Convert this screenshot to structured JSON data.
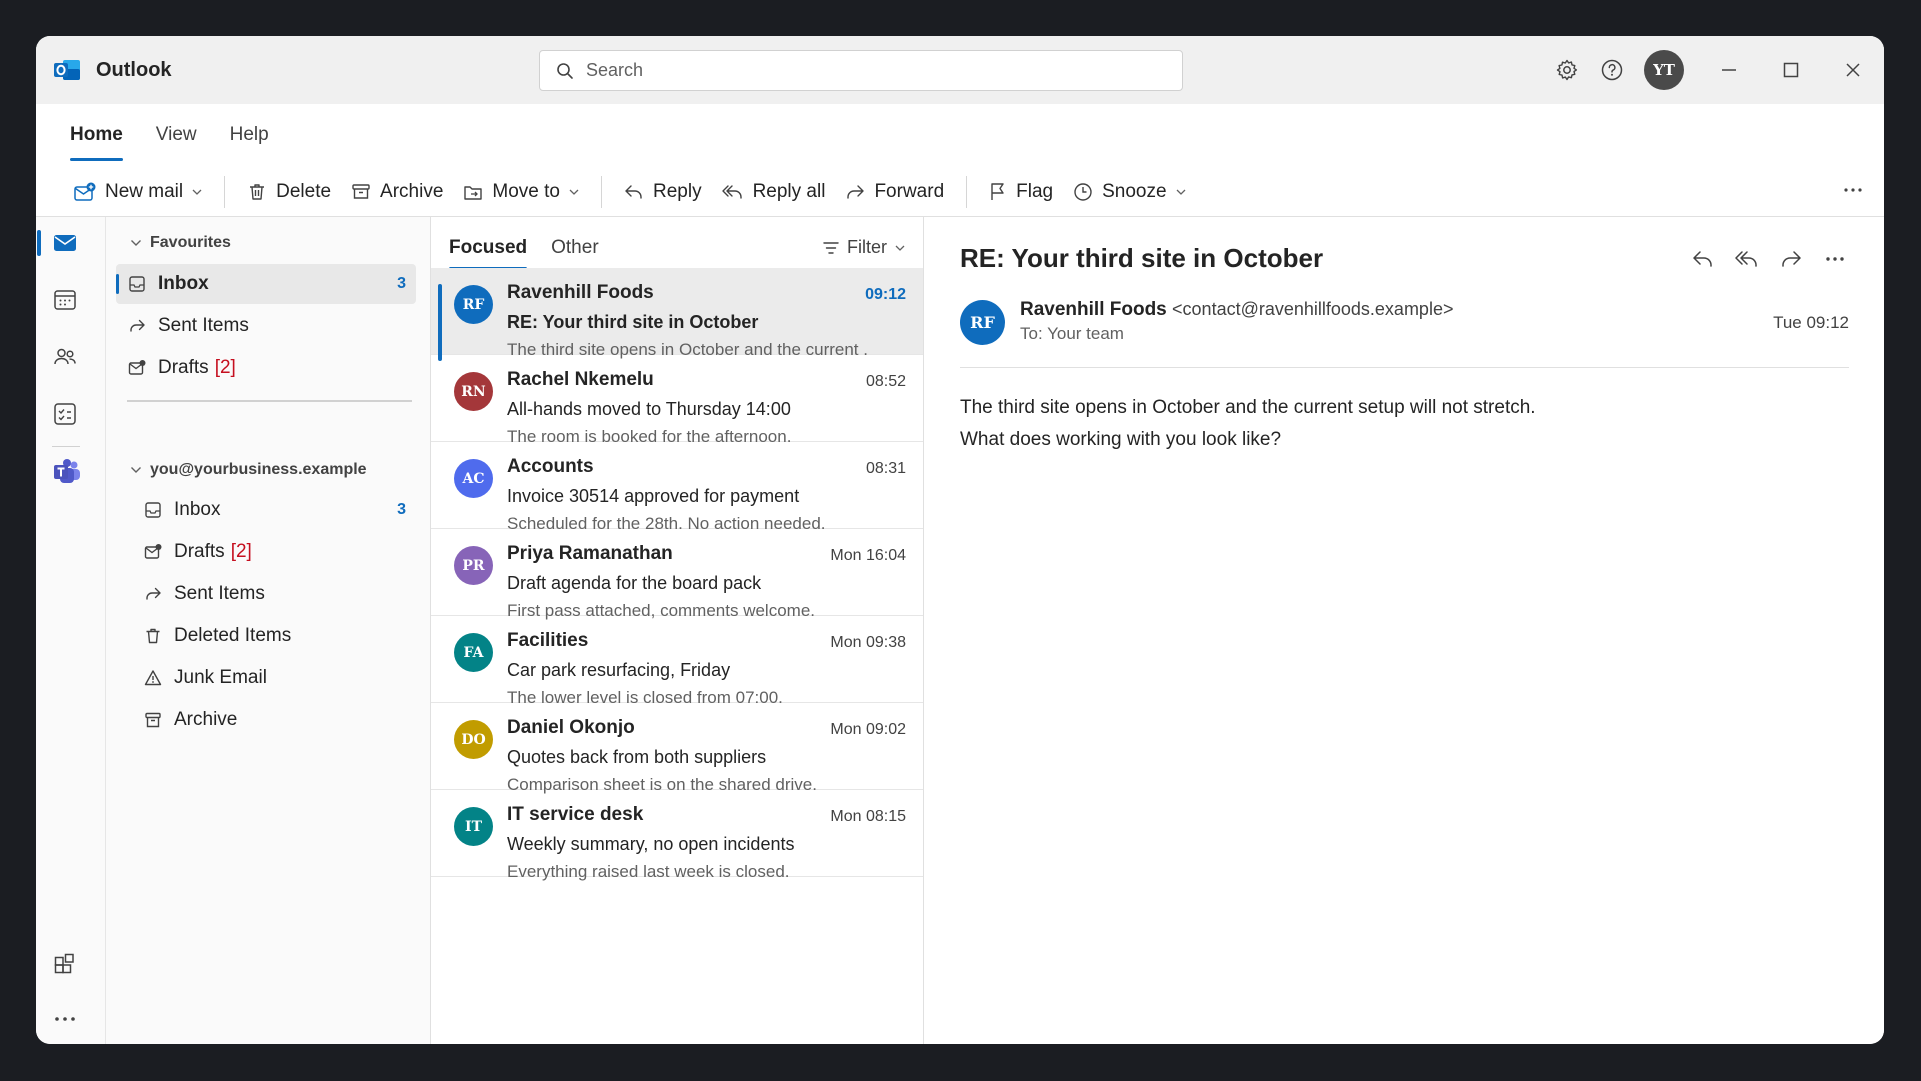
{
  "app": {
    "name": "Outlook",
    "brand_color": "#0f6cbd"
  },
  "search": {
    "placeholder": "Search"
  },
  "user": {
    "initials": "YT"
  },
  "ribbon_tabs": [
    "Home",
    "View",
    "Help"
  ],
  "toolbar": {
    "new_mail": "New mail",
    "delete": "Delete",
    "archive": "Archive",
    "move_to": "Move to",
    "reply": "Reply",
    "reply_all": "Reply all",
    "forward": "Forward",
    "flag": "Flag",
    "snooze": "Snooze"
  },
  "folders": {
    "favourites_header": "Favourites",
    "favourites": [
      {
        "label": "Inbox",
        "count": "3"
      },
      {
        "label": "Sent Items"
      },
      {
        "label": "Drafts",
        "badge": "[2]"
      }
    ],
    "account_header": "you@yourbusiness.example",
    "account": [
      {
        "label": "Inbox",
        "count": "3"
      },
      {
        "label": "Drafts",
        "badge": "[2]"
      },
      {
        "label": "Sent Items"
      },
      {
        "label": "Deleted Items"
      },
      {
        "label": "Junk Email"
      },
      {
        "label": "Archive"
      }
    ]
  },
  "list": {
    "tabs": [
      "Focused",
      "Other"
    ],
    "filter": "Filter",
    "messages": [
      {
        "initials": "RF",
        "from": "Ravenhill Foods",
        "time": "09:12",
        "subject": "RE: Your third site in October",
        "preview": "The third site opens in October and the current .",
        "color": "#0f6cbd"
      },
      {
        "initials": "RN",
        "from": "Rachel Nkemelu",
        "time": "08:52",
        "subject": "All-hands moved to Thursday 14:00",
        "preview": "The room is booked for the afternoon.",
        "color": "#a4373a"
      },
      {
        "initials": "AC",
        "from": "Accounts",
        "time": "08:31",
        "subject": "Invoice 30514 approved for payment",
        "preview": "Scheduled for the 28th. No action needed.",
        "color": "#4f6bed"
      },
      {
        "initials": "PR",
        "from": "Priya Ramanathan",
        "time": "Mon 16:04",
        "subject": "Draft agenda for the board pack",
        "preview": "First pass attached, comments welcome.",
        "color": "#8764b8"
      },
      {
        "initials": "FA",
        "from": "Facilities",
        "time": "Mon 09:38",
        "subject": "Car park resurfacing, Friday",
        "preview": "The lower level is closed from 07:00.",
        "color": "#038387"
      },
      {
        "initials": "DO",
        "from": "Daniel Okonjo",
        "time": "Mon 09:02",
        "subject": "Quotes back from both suppliers",
        "preview": "Comparison sheet is on the shared drive.",
        "color": "#c19c00"
      },
      {
        "initials": "IT",
        "from": "IT service desk",
        "time": "Mon 08:15",
        "subject": "Weekly summary, no open incidents",
        "preview": "Everything raised last week is closed.",
        "color": "#038387"
      }
    ]
  },
  "reading": {
    "subject": "RE: Your third site in October",
    "initials": "RF",
    "from_name": "Ravenhill Foods",
    "from_email": "<contact@ravenhillfoods.example>",
    "to": "To: Your team",
    "time": "Tue 09:12",
    "body": "The third site opens in October and the current setup will not stretch. What does working with you look like?"
  }
}
